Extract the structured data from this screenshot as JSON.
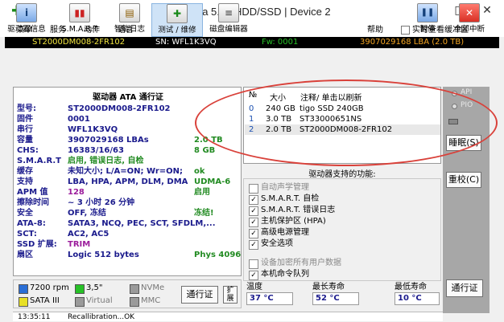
{
  "window": {
    "title": "Victoria 5.23 HDD/SSD | Device 2",
    "minimize_glyph": "—",
    "maximize_glyph": "□",
    "close_glyph": "✕",
    "app_icon_glyph": "✚"
  },
  "menu": {
    "items": [
      "菜单",
      "服务",
      "动作",
      "语言",
      "设置"
    ],
    "help": "帮助",
    "realtime_label": "实时查看缓冲区",
    "realtime_checked": false
  },
  "device_bar": {
    "model": "ST2000DM008-2FR102",
    "serial": "SN: WFL1K3VQ",
    "firmware": "Fw: 0001",
    "lba": "3907029168 LBA (2.0 TB)"
  },
  "toolbar": {
    "buttons": [
      {
        "label": "驱动器信息",
        "icon": "info-icon",
        "glyph": "i"
      },
      {
        "label": "S.M.A.R.T",
        "icon": "smart-chart-icon",
        "glyph": "▮▮"
      },
      {
        "label": "智能日志",
        "icon": "log-icon",
        "glyph": "▤"
      },
      {
        "label": "测试 / 维修",
        "icon": "test-plus-icon",
        "glyph": "✚"
      },
      {
        "label": "磁盘编辑器",
        "icon": "disk-editor-icon",
        "glyph": "≡"
      }
    ],
    "pause_label": "暂停",
    "pause_glyph": "❚❚",
    "interrupt_label": "全部中断",
    "interrupt_glyph": "✕"
  },
  "drive_info": {
    "header": "驱动器 ATA 通行证",
    "rows": [
      {
        "label": "型号:",
        "value": "ST2000DM008-2FR102",
        "extra": ""
      },
      {
        "label": "固件",
        "value": "0001",
        "extra": ""
      },
      {
        "label": "串行",
        "value": "WFL1K3VQ",
        "extra": ""
      },
      {
        "label": "容量",
        "value": "3907029168 LBAs",
        "extra": "2.0 TB"
      },
      {
        "label": "CHS:",
        "value": "16383/16/63",
        "extra": "8 GB"
      },
      {
        "label": "S.M.A.R.T",
        "value": "启用, 错误日志, 自检",
        "extra": ""
      },
      {
        "label": "缓存",
        "value": "未知大小; L/A=ON; Wr=ON;",
        "extra": "ok"
      },
      {
        "label": "支持",
        "value": "LBA, HPA, APM, DLM, DMA",
        "extra": "UDMA-6"
      },
      {
        "label": "APM 值",
        "value": "128",
        "extra": "启用"
      },
      {
        "label": "擦除时间",
        "value": "~ 3 小时 26 分钟",
        "extra": ""
      },
      {
        "label": "安全",
        "value": "OFF, 冻结",
        "extra": "冻结!"
      },
      {
        "label": "ATA-8:",
        "value": "SATA3, NCQ, PEC, SCT, SFDLM,...",
        "extra": ""
      },
      {
        "label": "SCT:",
        "value": "AC2, AC5",
        "extra": ""
      },
      {
        "label": "SSD 扩展:",
        "value": "TRIM",
        "extra": ""
      },
      {
        "label": "扇区",
        "value": "Logic 512 bytes",
        "extra": "Phys 4096"
      }
    ]
  },
  "device_list": {
    "headers": [
      "№",
      "大小",
      "注释/ 单击以刷新"
    ],
    "rows": [
      {
        "num": "0",
        "size": "240 GB",
        "comment": "tigo SSD 240GB"
      },
      {
        "num": "1",
        "size": "3.0 TB",
        "comment": "ST33000651NS"
      },
      {
        "num": "2",
        "size": "2.0 TB",
        "comment": "ST2000DM008-2FR102"
      }
    ]
  },
  "features": {
    "title": "驱动器支持的功能:",
    "items": [
      {
        "label": "自动声学管理",
        "checked": false
      },
      {
        "label": "S.M.A.R.T. 自检",
        "checked": true
      },
      {
        "label": "S.M.A.R.T. 错误日志",
        "checked": true
      },
      {
        "label": "主机保护区 (HPA)",
        "checked": true
      },
      {
        "label": "高级电源管理",
        "checked": true
      },
      {
        "label": "安全选项",
        "checked": true
      },
      {
        "label": "设备加密所有用户数据",
        "checked": false
      },
      {
        "label": "本机命令队列",
        "checked": true
      }
    ]
  },
  "legend": {
    "items": [
      {
        "label": "7200 rpm",
        "color": "#2b6fd6"
      },
      {
        "label": "3,5\"",
        "color": "#27c127"
      },
      {
        "label": "NVMe",
        "color": "#9a9a9a"
      },
      {
        "label": "SATA III",
        "color": "#e8e025"
      },
      {
        "label": "Virtual",
        "color": "#9a9a9a"
      },
      {
        "label": "MMC",
        "color": "#9a9a9a"
      }
    ],
    "passport_button": "通行证",
    "expand_button": "扩展"
  },
  "temps": {
    "temperature_label": "温度",
    "temperature_value": "37 °C",
    "max_life_label": "最长寿命",
    "max_life_value": "52 °C",
    "min_life_label": "最低寿命",
    "min_life_value": "10 °C"
  },
  "side_panel": {
    "api_label": "API",
    "pio_label": "PIO",
    "sleep_button": "睡眠(S)",
    "recal_button": "重校(C)",
    "passport_button": "通行证"
  },
  "status": {
    "time": "13:35:11",
    "message": "Recallibration...OK"
  },
  "colors": {
    "device_bar_bg": "#000000",
    "model_text": "#f2e641",
    "lba_text": "#f5a623",
    "info_text": "#1a1a8c",
    "annotation": "#d9413a",
    "close_red": "#d93025"
  }
}
